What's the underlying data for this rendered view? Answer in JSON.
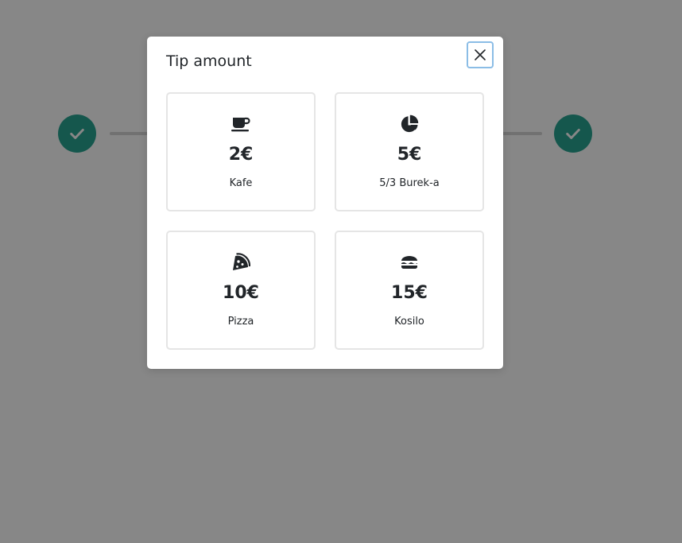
{
  "modal": {
    "title": "Tip amount",
    "close_icon": "close-icon"
  },
  "options": [
    {
      "icon": "coffee-icon",
      "amount": "2€",
      "label": "Kafe"
    },
    {
      "icon": "pie-chart-icon",
      "amount": "5€",
      "label": "5/3 Burek-a"
    },
    {
      "icon": "pizza-icon",
      "amount": "10€",
      "label": "Pizza"
    },
    {
      "icon": "hamburger-icon",
      "amount": "15€",
      "label": "Kosilo"
    }
  ],
  "stepper": {
    "steps": [
      {
        "status": "completed",
        "icon": "check-icon"
      },
      {
        "status": "completed",
        "icon": "check-icon"
      }
    ],
    "accent_color": "#28a492"
  },
  "colors": {
    "overlay": "rgba(0,0,0,0.47)",
    "text": "#212529",
    "card_border": "#e5e5e5",
    "focus_ring": "#8bbde6"
  }
}
